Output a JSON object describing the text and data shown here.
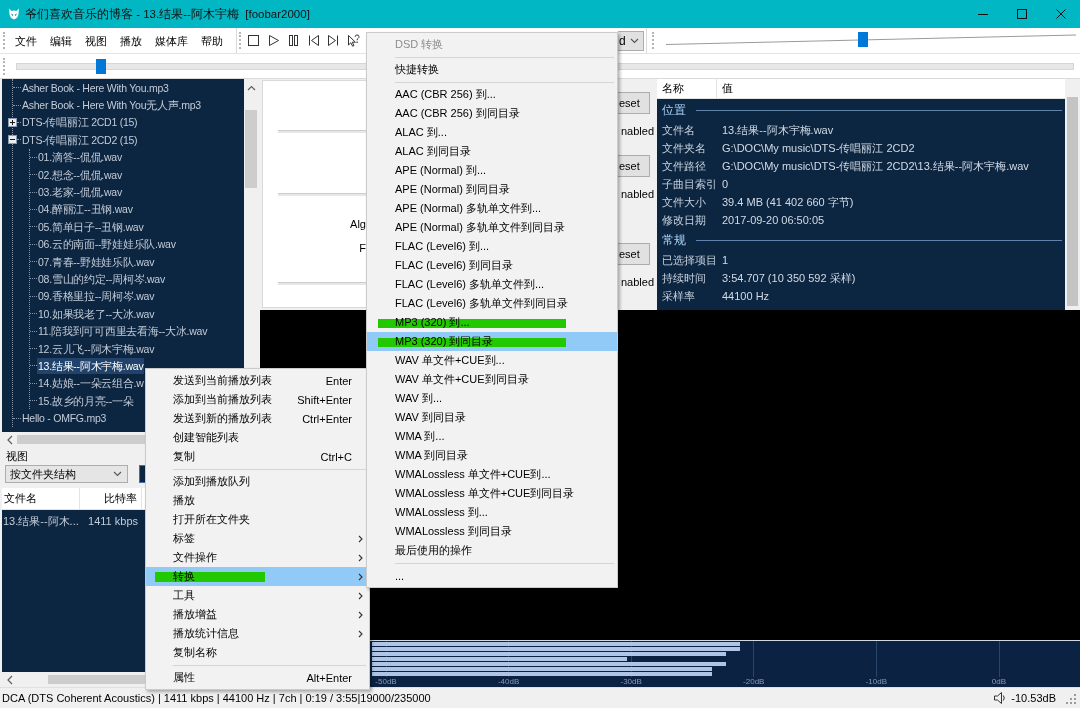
{
  "window": {
    "title": "爷们喜欢音乐的博客 - 13.结果--阿木宇梅  [foobar2000]"
  },
  "menu_bar": [
    "文件",
    "编辑",
    "视图",
    "播放",
    "媒体库",
    "帮助"
  ],
  "toolbar": {
    "buttons": [
      {
        "kind": "stop"
      },
      {
        "kind": "play"
      },
      {
        "kind": "pause"
      },
      {
        "kind": "previous"
      },
      {
        "kind": "next"
      },
      {
        "kind": "random"
      }
    ],
    "order_dropdown": {
      "value": "d"
    },
    "volume": {
      "level": 0.48
    }
  },
  "seekbar": {
    "level": 0.08
  },
  "library_tree": {
    "items": [
      {
        "kind": "file",
        "label": "Asher Book - Here With You.mp3",
        "selected": false
      },
      {
        "kind": "file",
        "label": "Asher Book - Here With You无人声.mp3",
        "selected": false
      },
      {
        "kind": "folder",
        "label": "DTS-传唱丽江 2CD1 (15)",
        "expanded": false,
        "selected": false
      },
      {
        "kind": "folder",
        "label": "DTS-传唱丽江 2CD2 (15)",
        "expanded": true,
        "selected": false,
        "children": [
          {
            "kind": "file",
            "label": "01.滴答--侃侃.wav",
            "selected": false
          },
          {
            "kind": "file",
            "label": "02.想念--侃侃.wav",
            "selected": false
          },
          {
            "kind": "file",
            "label": "03.老家--侃侃.wav",
            "selected": false
          },
          {
            "kind": "file",
            "label": "04.醉丽江--丑钢.wav",
            "selected": false
          },
          {
            "kind": "file",
            "label": "05.简单日子--丑钢.wav",
            "selected": false
          },
          {
            "kind": "file",
            "label": "06.云的南面--野娃娃乐队.wav",
            "selected": false
          },
          {
            "kind": "file",
            "label": "07.青春--野娃娃乐队.wav",
            "selected": false
          },
          {
            "kind": "file",
            "label": "08.雪山的约定--周柯岑.wav",
            "selected": false
          },
          {
            "kind": "file",
            "label": "09.香格里拉--周柯岑.wav",
            "selected": false
          },
          {
            "kind": "file",
            "label": "10.如果我老了--大冰.wav",
            "selected": false
          },
          {
            "kind": "file",
            "label": "11.陪我到可可西里去看海--大冰.wav",
            "selected": false
          },
          {
            "kind": "file",
            "label": "12.云儿飞--阿木宇梅.wav",
            "selected": false
          },
          {
            "kind": "file",
            "label": "13.结果--阿木宇梅.wav",
            "selected": true
          },
          {
            "kind": "file",
            "label": "14.姑娘--一朵云组合.w",
            "selected": false
          },
          {
            "kind": "file",
            "label": "15.故乡的月亮--一朵",
            "selected": false
          }
        ]
      },
      {
        "kind": "file",
        "label": "Hello - OMFG.mp3",
        "selected": false
      }
    ]
  },
  "view": {
    "label": "视图",
    "dropdown": {
      "value": "按文件夹结构"
    }
  },
  "file_list": {
    "columns": [
      "文件名",
      "比特率"
    ],
    "rows": [
      [
        "13.结果--阿木...",
        "1411 kbps"
      ]
    ]
  },
  "settings_panel": {
    "labels": [
      "Alg",
      "F"
    ],
    "sections": [
      {
        "button": "eset",
        "text": "nabled"
      },
      {
        "button": "eset",
        "text": "nabled"
      },
      {
        "button": "eset",
        "text": "nabled"
      }
    ]
  },
  "properties": {
    "columns": [
      "名称",
      "值"
    ],
    "groups": [
      {
        "title": "位置",
        "rows": [
          [
            "文件名",
            "13.结果--阿木宇梅.wav"
          ],
          [
            "文件夹名",
            "G:\\DOC\\My music\\DTS-传唱丽江 2CD2"
          ],
          [
            "文件路径",
            "G:\\DOC\\My music\\DTS-传唱丽江 2CD2\\13.结果--阿木宇梅.wav"
          ],
          [
            "子曲目索引",
            "0"
          ],
          [
            "文件大小",
            "39.4 MB (41 402 660 字节)"
          ],
          [
            "修改日期",
            "2017-09-20 06:50:05"
          ]
        ]
      },
      {
        "title": "常规",
        "rows": [
          [
            "已选择项目",
            "1"
          ],
          [
            "持续时间",
            "3:54.707 (10 350 592 采样)"
          ],
          [
            "采样率",
            "44100 Hz"
          ]
        ]
      }
    ]
  },
  "peak_meter": {
    "channels": [
      {
        "level": 0.52
      },
      {
        "level": 0.52
      },
      {
        "level": 0.5
      },
      {
        "level": 0.36
      },
      {
        "level": 0.5
      },
      {
        "level": 0.48
      },
      {
        "level": 0.48
      }
    ],
    "scale": [
      "-50dB",
      "-40dB",
      "-30dB",
      "-20dB",
      "-10dB",
      "0dB"
    ]
  },
  "status_bar": {
    "text": "DCA (DTS Coherent Acoustics) | 1411 kbps | 44100 Hz | 7ch | 0:19 / 3:55|19000/235000",
    "volume": "-10.53dB"
  },
  "context_menu": {
    "items": [
      {
        "kind": "item",
        "label": "发送到当前播放列表",
        "shortcut": "Enter",
        "submenu": false,
        "selected": false,
        "marked": false
      },
      {
        "kind": "item",
        "label": "添加到当前播放列表",
        "shortcut": "Shift+Enter",
        "submenu": false,
        "selected": false,
        "marked": false
      },
      {
        "kind": "item",
        "label": "发送到新的播放列表",
        "shortcut": "Ctrl+Enter",
        "submenu": false,
        "selected": false,
        "marked": false
      },
      {
        "kind": "item",
        "label": "创建智能列表",
        "submenu": false,
        "selected": false,
        "marked": false
      },
      {
        "kind": "item",
        "label": "复制",
        "shortcut": "Ctrl+C",
        "submenu": false,
        "selected": false,
        "marked": false
      },
      {
        "kind": "separator"
      },
      {
        "kind": "item",
        "label": "添加到播放队列",
        "submenu": false,
        "selected": false,
        "marked": false
      },
      {
        "kind": "item",
        "label": "播放",
        "submenu": false,
        "selected": false,
        "marked": false
      },
      {
        "kind": "item",
        "label": "打开所在文件夹",
        "submenu": false,
        "selected": false,
        "marked": false
      },
      {
        "kind": "item",
        "label": "标签",
        "submenu": true,
        "selected": false,
        "marked": false
      },
      {
        "kind": "item",
        "label": "文件操作",
        "submenu": true,
        "selected": false,
        "marked": false
      },
      {
        "kind": "item",
        "label": "转换",
        "submenu": true,
        "selected": true,
        "marked": true
      },
      {
        "kind": "item",
        "label": "工具",
        "submenu": true,
        "selected": false,
        "marked": false
      },
      {
        "kind": "item",
        "label": "播放增益",
        "submenu": true,
        "selected": false,
        "marked": false
      },
      {
        "kind": "item",
        "label": "播放统计信息",
        "submenu": true,
        "selected": false,
        "marked": false
      },
      {
        "kind": "item",
        "label": "复制名称",
        "submenu": false,
        "selected": false,
        "marked": false
      },
      {
        "kind": "separator"
      },
      {
        "kind": "item",
        "label": "属性",
        "shortcut": "Alt+Enter",
        "submenu": false,
        "selected": false,
        "marked": false
      }
    ]
  },
  "convert_submenu": {
    "items": [
      {
        "kind": "item",
        "label": "DSD 转换",
        "disabled": true,
        "selected": false,
        "marked": false
      },
      {
        "kind": "separator"
      },
      {
        "kind": "item",
        "label": "快捷转换",
        "disabled": false,
        "selected": false,
        "marked": false
      },
      {
        "kind": "separator"
      },
      {
        "kind": "item",
        "label": "AAC (CBR 256) 到...",
        "disabled": false,
        "selected": false,
        "marked": false
      },
      {
        "kind": "item",
        "label": "AAC (CBR 256) 到同目录",
        "disabled": false,
        "selected": false,
        "marked": false
      },
      {
        "kind": "item",
        "label": "ALAC 到...",
        "disabled": false,
        "selected": false,
        "marked": false
      },
      {
        "kind": "item",
        "label": "ALAC 到同目录",
        "disabled": false,
        "selected": false,
        "marked": false
      },
      {
        "kind": "item",
        "label": "APE (Normal) 到...",
        "disabled": false,
        "selected": false,
        "marked": false
      },
      {
        "kind": "item",
        "label": "APE (Normal) 到同目录",
        "disabled": false,
        "selected": false,
        "marked": false
      },
      {
        "kind": "item",
        "label": "APE (Normal) 多轨单文件到...",
        "disabled": false,
        "selected": false,
        "marked": false
      },
      {
        "kind": "item",
        "label": "APE (Normal) 多轨单文件到同目录",
        "disabled": false,
        "selected": false,
        "marked": false
      },
      {
        "kind": "item",
        "label": "FLAC (Level6) 到...",
        "disabled": false,
        "selected": false,
        "marked": false
      },
      {
        "kind": "item",
        "label": "FLAC (Level6) 到同目录",
        "disabled": false,
        "selected": false,
        "marked": false
      },
      {
        "kind": "item",
        "label": "FLAC (Level6) 多轨单文件到...",
        "disabled": false,
        "selected": false,
        "marked": false
      },
      {
        "kind": "item",
        "label": "FLAC (Level6) 多轨单文件到同目录",
        "disabled": false,
        "selected": false,
        "marked": false
      },
      {
        "kind": "item",
        "label": "MP3 (320) 到...",
        "disabled": false,
        "selected": false,
        "marked": true
      },
      {
        "kind": "item",
        "label": "MP3 (320) 到同目录",
        "disabled": false,
        "selected": true,
        "marked": true
      },
      {
        "kind": "item",
        "label": "WAV 单文件+CUE到...",
        "disabled": false,
        "selected": false,
        "marked": false
      },
      {
        "kind": "item",
        "label": "WAV 单文件+CUE到同目录",
        "disabled": false,
        "selected": false,
        "marked": false
      },
      {
        "kind": "item",
        "label": "WAV 到...",
        "disabled": false,
        "selected": false,
        "marked": false
      },
      {
        "kind": "item",
        "label": "WAV 到同目录",
        "disabled": false,
        "selected": false,
        "marked": false
      },
      {
        "kind": "item",
        "label": "WMA 到...",
        "disabled": false,
        "selected": false,
        "marked": false
      },
      {
        "kind": "item",
        "label": "WMA 到同目录",
        "disabled": false,
        "selected": false,
        "marked": false
      },
      {
        "kind": "item",
        "label": "WMALossless 单文件+CUE到...",
        "disabled": false,
        "selected": false,
        "marked": false
      },
      {
        "kind": "item",
        "label": "WMALossless 单文件+CUE到同目录",
        "disabled": false,
        "selected": false,
        "marked": false
      },
      {
        "kind": "item",
        "label": "WMALossless 到...",
        "disabled": false,
        "selected": false,
        "marked": false
      },
      {
        "kind": "item",
        "label": "WMALossless 到同目录",
        "disabled": false,
        "selected": false,
        "marked": false
      },
      {
        "kind": "item",
        "label": "最后使用的操作",
        "disabled": false,
        "selected": false,
        "marked": false
      },
      {
        "kind": "separator"
      },
      {
        "kind": "item",
        "label": "...",
        "disabled": false,
        "selected": false,
        "marked": false
      }
    ]
  }
}
